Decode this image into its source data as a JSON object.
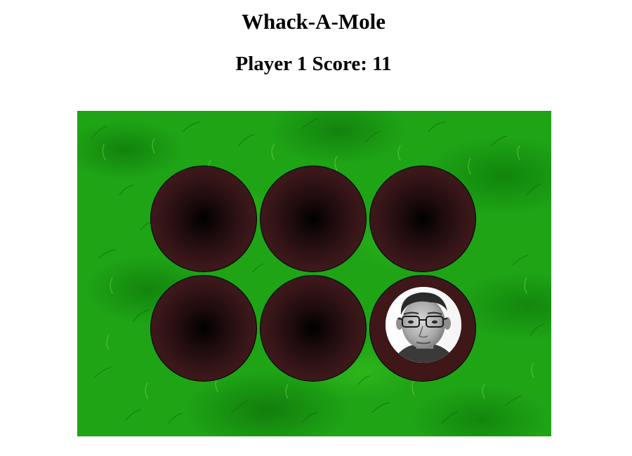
{
  "game": {
    "title": "Whack-A-Mole",
    "score_text": "Player 1 Score: 11"
  },
  "board": {
    "rows": 2,
    "columns": 3,
    "active_hole": 6,
    "mole_icon": "face-photo-icon",
    "colors": {
      "grass": "#1fa416",
      "hole": "#451b1d",
      "hole_center": "#000000"
    }
  }
}
